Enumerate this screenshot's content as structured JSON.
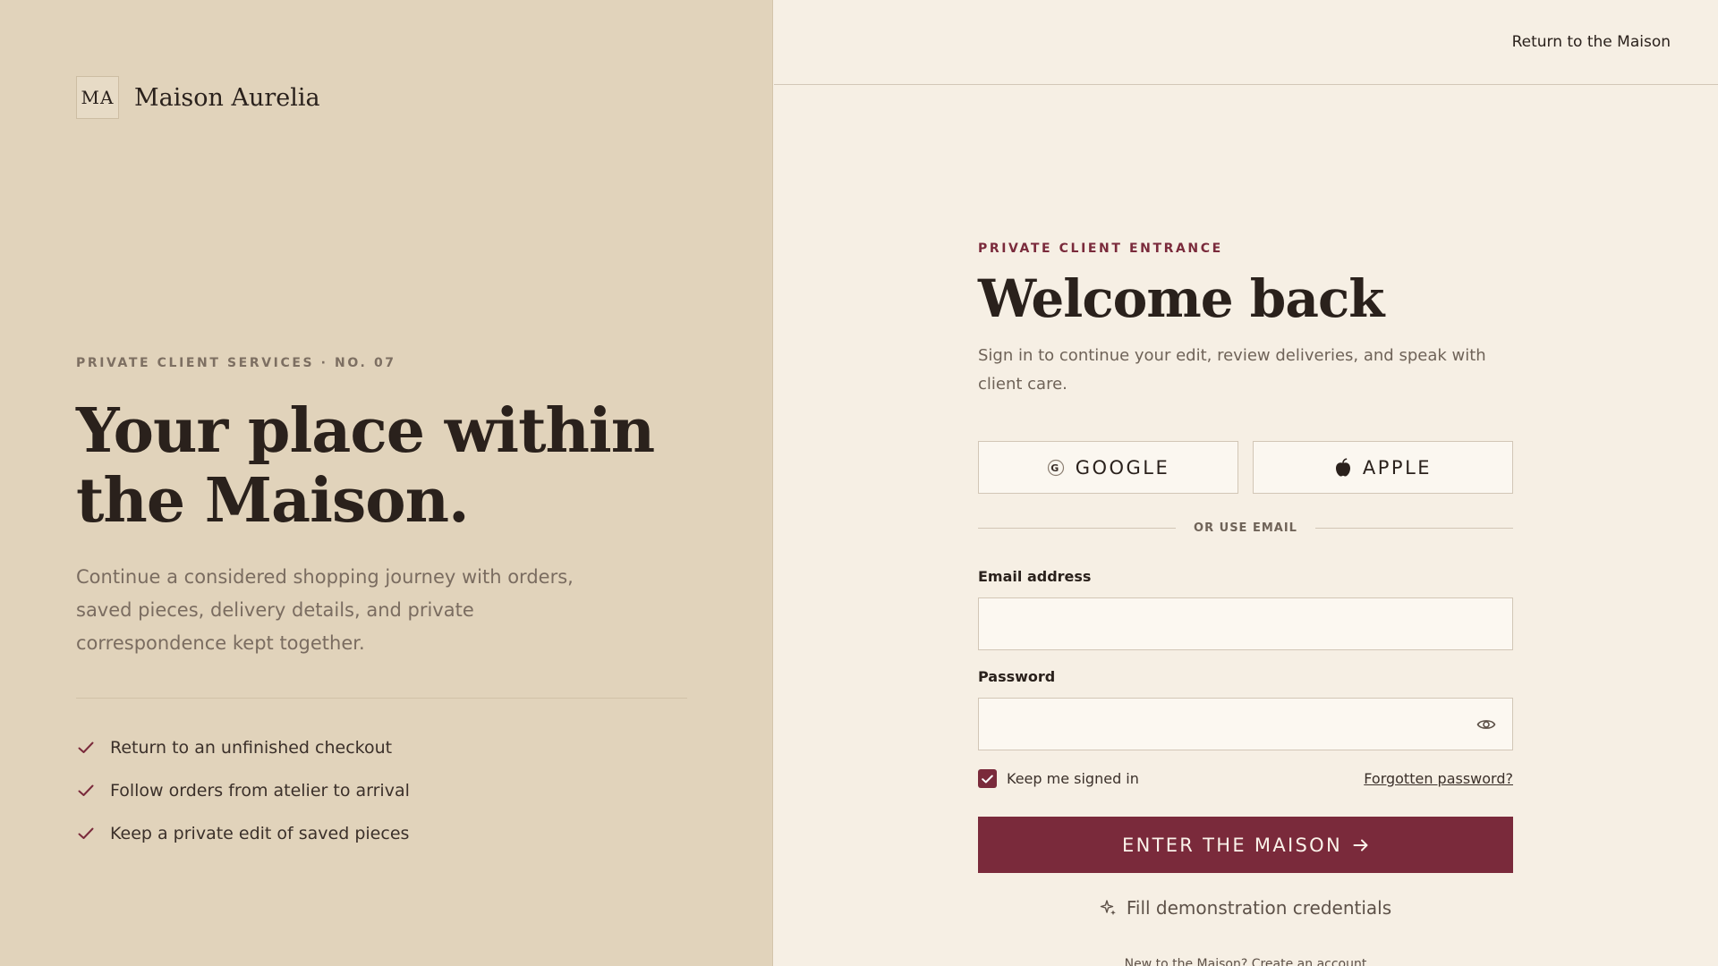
{
  "brand": {
    "monogram": "MA",
    "name": "Maison Aurelia"
  },
  "hero": {
    "eyebrow": "PRIVATE CLIENT SERVICES · NO. 07",
    "title": "Your place within the Maison.",
    "subtitle": "Continue a considered shopping journey with orders, saved pieces, delivery details, and private correspondence kept together.",
    "benefits": [
      "Return to an unfinished checkout",
      "Follow orders from atelier to arrival",
      "Keep a private edit of saved pieces"
    ]
  },
  "topbar": {
    "return_link": "Return to the Maison"
  },
  "form": {
    "eyebrow": "PRIVATE CLIENT ENTRANCE",
    "title": "Welcome back",
    "intro": "Sign in to continue your edit, review deliveries, and speak with client care.",
    "google_label": "GOOGLE",
    "apple_label": "APPLE",
    "divider_text": "OR USE EMAIL",
    "email_label": "Email address",
    "email_value": "",
    "password_label": "Password",
    "password_value": "",
    "remember_label": "Keep me signed in",
    "remember_checked": true,
    "forgot_label": "Forgotten password?",
    "submit_label": "ENTER THE MAISON",
    "demo_label": "Fill demonstration credentials",
    "register_prompt": "New to the Maison? Create an account"
  },
  "icons": {
    "google": "google-icon",
    "apple": "apple-icon",
    "eye": "eye-icon",
    "check": "check-icon",
    "arrow": "arrow-right-icon",
    "sparkle": "sparkle-icon"
  },
  "colors": {
    "accent": "#7a2a3b",
    "left_panel": "#e1d3bb",
    "right_panel": "#f6efe4",
    "text_dark": "#2a211c"
  }
}
